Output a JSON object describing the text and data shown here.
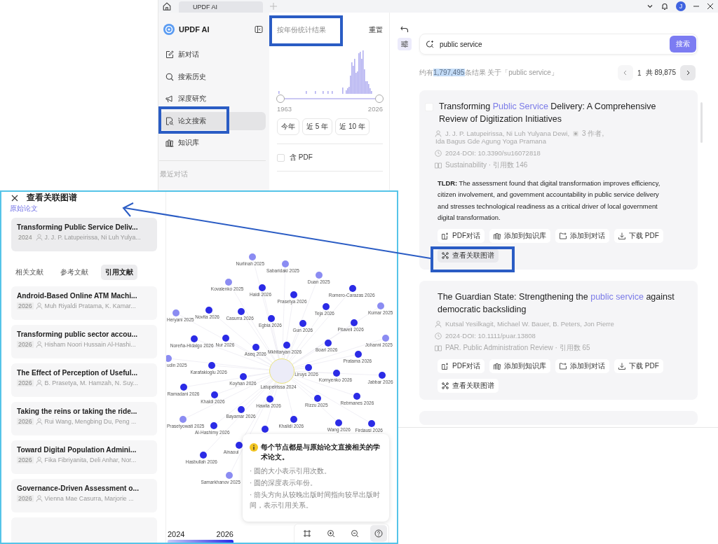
{
  "titlebar": {
    "tabs": [
      {
        "label": "UPDF AI",
        "selected": true
      }
    ],
    "avatar": "J"
  },
  "sidebar": {
    "brand": "UPDF AI",
    "items": [
      {
        "label": "新对话",
        "kind": "new-chat",
        "selected": false
      },
      {
        "label": "搜索历史",
        "kind": "history",
        "selected": false
      },
      {
        "label": "深度研究",
        "kind": "research",
        "selected": false
      },
      {
        "label": "论文搜索",
        "kind": "papers",
        "selected": true
      },
      {
        "label": "知识库",
        "kind": "knowledge",
        "selected": false
      }
    ],
    "section": "最近对话"
  },
  "filter": {
    "title": "按年份统计结果",
    "reset": "重置",
    "range": [
      {
        "level": 0
      },
      {
        "level": 1
      }
    ],
    "range_start": "1963",
    "range_end": "2026",
    "presets": [
      "今年",
      "近 5 年",
      "近 10 年"
    ],
    "pdf_only": {
      "label": "含 PDF",
      "checked": false
    }
  },
  "search": {
    "value": "public service",
    "button": "搜索"
  },
  "summary": {
    "prefix": "约有",
    "count": "1,797,495",
    "suffix": "条结果 关于「public service」"
  },
  "pagination": {
    "page": "1",
    "total": "共 89,875"
  },
  "results": [
    {
      "checkbox": {
        "checked": false
      },
      "title": [
        {
          "text": "Transforming ",
          "highlight": false
        },
        {
          "text": "Public Service",
          "highlight": true
        },
        {
          "text": " Delivery: A Comprehensive Review of Digitization Initiatives",
          "highlight": false
        }
      ],
      "authors": "J. J. P. Latupeirissa,  Ni Luh Yulyana Dewi,",
      "more_authors": "3 作者,",
      "authors_more": "Ida Bagus Gde Agung Yoga Pramana",
      "doi": "2024·DOI: 10.3390/su16072818",
      "journal": "Sustainability · 引用数 146",
      "tldr": "**TLDR:** The assessment found that digital transformation improves efficiency, citizen involvement, and government accountability in public service delivery and stresses technological readiness as a critical driver of local government digital transformation.",
      "actions": [
        {
          "label": "PDF对话",
          "kind": "chat",
          "selected": false
        },
        {
          "label": "添加到知识库",
          "kind": "knowledge",
          "selected": false
        },
        {
          "label": "添加到对话",
          "kind": "add",
          "selected": false
        },
        {
          "label": "下载 PDF",
          "kind": "download",
          "selected": false
        },
        {
          "label": "查看关联图谱",
          "kind": "graph",
          "selected": true
        }
      ]
    },
    {
      "title": [
        {
          "text": "The Guardian State: Strengthening the ",
          "highlight": false
        },
        {
          "text": "public service",
          "highlight": true
        },
        {
          "text": " against democratic backsliding",
          "highlight": false
        }
      ],
      "authors": "Kutsal Yesilkagit,  Michael W. Bauer,  B. Peters,  Jon Pierre",
      "doi": "2024·DOI: 10.1111/puar.13808",
      "journal": "PAR. Public Administration Review · 引用数 65",
      "actions": [
        {
          "label": "PDF对话",
          "kind": "chat",
          "selected": false
        },
        {
          "label": "添加到知识库",
          "kind": "knowledge",
          "selected": false
        },
        {
          "label": "添加到对话",
          "kind": "add",
          "selected": false
        },
        {
          "label": "下载 PDF",
          "kind": "download",
          "selected": false
        },
        {
          "label": "查看关联图谱",
          "kind": "graph",
          "selected": false
        }
      ]
    }
  ],
  "graph_panel": {
    "title": "查看关联图谱",
    "origin_label": "原始论文",
    "origin": {
      "title": "Transforming Public Service Deliv...",
      "year": "2024",
      "authors": "J. J. P. Latupeirissa, Ni Luh Yulya..."
    },
    "tabs": [
      {
        "label": "相关文献",
        "selected": false
      },
      {
        "label": "参考文献",
        "selected": false
      },
      {
        "label": "引用文献",
        "selected": true
      }
    ],
    "papers": [
      {
        "title": "Android-Based Online ATM Machi...",
        "year": "2026",
        "authors": "Muh Riyaldi Pratama, K. Kamar..."
      },
      {
        "title": "Transforming public sector accou...",
        "year": "2026",
        "authors": "Hisham Noori Hussain Al-Hashi..."
      },
      {
        "title": "The Effect of Perception of Useful...",
        "year": "2026",
        "authors": "B. Prasetya, M. Hamzah, N. Suy..."
      },
      {
        "title": "Taking the reins or taking the ride...",
        "year": "2026",
        "authors": "Rui Wang, Mengbing Du, Peng ..."
      },
      {
        "title": "Toward Digital Population Admini...",
        "year": "2026",
        "authors": "Fika Fibriyanita, Deli Anhar, Nor..."
      },
      {
        "title": "Governance-Driven Assessment o...",
        "year": "2026",
        "authors": "Vienna Mae Casurra, Marjorie ..."
      }
    ],
    "nodes": [
      {
        "label": "Nurlinah 2025",
        "kind": "paper",
        "color": "#8b8cf2"
      },
      {
        "label": "Sabaridaki 2025",
        "kind": "paper",
        "color": "#8b8cf2"
      },
      {
        "label": "Duan 2025",
        "kind": "paper",
        "color": "#8b8cf2"
      },
      {
        "label": "Kovalenko 2025",
        "kind": "paper",
        "color": "#8b8cf2"
      },
      {
        "label": "Haidi 2026",
        "kind": "paper",
        "color": "#2b2be6"
      },
      {
        "label": "Prasetya 2026",
        "kind": "paper",
        "color": "#2b2be6"
      },
      {
        "label": "Romero-Carazas 2026",
        "kind": "paper",
        "color": "#2b2be6"
      },
      {
        "label": "Kumar 2025",
        "kind": "paper",
        "color": "#8b8cf2"
      },
      {
        "label": "Heryani 2025",
        "kind": "paper",
        "color": "#8b8cf2"
      },
      {
        "label": "Novita 2026",
        "kind": "paper",
        "color": "#2b2be6"
      },
      {
        "label": "Casurra 2026",
        "kind": "paper",
        "color": "#2b2be6"
      },
      {
        "label": "Egbia 2026",
        "kind": "paper",
        "color": "#2b2be6"
      },
      {
        "label": "Teja 2026",
        "kind": "paper",
        "color": "#2b2be6"
      },
      {
        "label": "Gun 2026",
        "kind": "paper",
        "color": "#2b2be6"
      },
      {
        "label": "Pitaveli 2026",
        "kind": "paper",
        "color": "#2b2be6"
      },
      {
        "label": "Noreña-Hidalgo 2026",
        "kind": "paper",
        "color": "#2b2be6"
      },
      {
        "label": "Nur 2026",
        "kind": "paper",
        "color": "#2b2be6"
      },
      {
        "label": "Aseq 2026",
        "kind": "paper",
        "color": "#2b2be6"
      },
      {
        "label": "Mkhitaryan 2026",
        "kind": "paper",
        "color": "#2b2be6"
      },
      {
        "label": "Boari 2026",
        "kind": "paper",
        "color": "#2b2be6"
      },
      {
        "label": "Johanni 2025",
        "kind": "paper",
        "color": "#8b8cf2"
      },
      {
        "label": "udin 2025",
        "kind": "paper",
        "color": "#8b8cf2"
      },
      {
        "label": "Pratama 2026",
        "kind": "paper",
        "color": "#2b2be6"
      },
      {
        "label": "Karafakioglu 2026",
        "kind": "paper",
        "color": "#2b2be6"
      },
      {
        "label": "Latupeirissa 2024",
        "kind": "origin",
        "color": "#ececf8"
      },
      {
        "label": "Liruys 2026",
        "kind": "paper",
        "color": "#2b2be6"
      },
      {
        "label": "Kornyenko 2026",
        "kind": "paper",
        "color": "#2b2be6"
      },
      {
        "label": "Jabbar 2026",
        "kind": "paper",
        "color": "#2b2be6"
      },
      {
        "label": "Koyhan 2026",
        "kind": "paper",
        "color": "#2b2be6"
      },
      {
        "label": "Ramadani 2026",
        "kind": "paper",
        "color": "#2b2be6"
      },
      {
        "label": "Khaldi 2026",
        "kind": "paper",
        "color": "#2b2be6"
      },
      {
        "label": "Hawila 2026",
        "kind": "paper",
        "color": "#2b2be6"
      },
      {
        "label": "Rizzu 2025",
        "kind": "paper",
        "color": "#2b2be6"
      },
      {
        "label": "Rebmanes 2026",
        "kind": "paper",
        "color": "#2b2be6"
      },
      {
        "label": "Bayamar 2026",
        "kind": "paper",
        "color": "#2b2be6"
      },
      {
        "label": "Prasetyowati 2025",
        "kind": "paper",
        "color": "#8b8cf2"
      },
      {
        "label": "Al-Hashimy 2026",
        "kind": "paper",
        "color": "#2b2be6"
      },
      {
        "label": "Khalidi 2026",
        "kind": "paper",
        "color": "#2b2be6"
      },
      {
        "label": "Wang 2026",
        "kind": "paper",
        "color": "#2b2be6"
      },
      {
        "label": "Firdausi 2026",
        "kind": "paper",
        "color": "#2b2be6"
      },
      {
        "kind": "paper",
        "color": "#2b2be6"
      },
      {
        "label": "Ainaoui",
        "kind": "paper",
        "color": "#2b2be6"
      },
      {
        "label": "Hasbullah 2026",
        "kind": "paper",
        "color": "#2b2be6"
      },
      {
        "label": "Samarkhanov 2025",
        "kind": "paper",
        "color": "#8b8cf2"
      }
    ],
    "legend": {
      "start": "2024",
      "end": "2026"
    },
    "tools": [
      {
        "kind": "fit",
        "selected": false
      },
      {
        "kind": "zoom-in",
        "selected": false
      },
      {
        "kind": "zoom-out",
        "selected": false
      },
      {
        "kind": "help",
        "selected": true
      }
    ],
    "tooltip": {
      "title": "每个节点都是与原始论文直接相关的学术论文。",
      "lines": [
        "· 圆的大小表示引用次数。",
        "· 圆的深度表示年份。",
        "· 箭头方向从较晚出版时间指向较早出版时间，表示引用关系。"
      ]
    }
  }
}
